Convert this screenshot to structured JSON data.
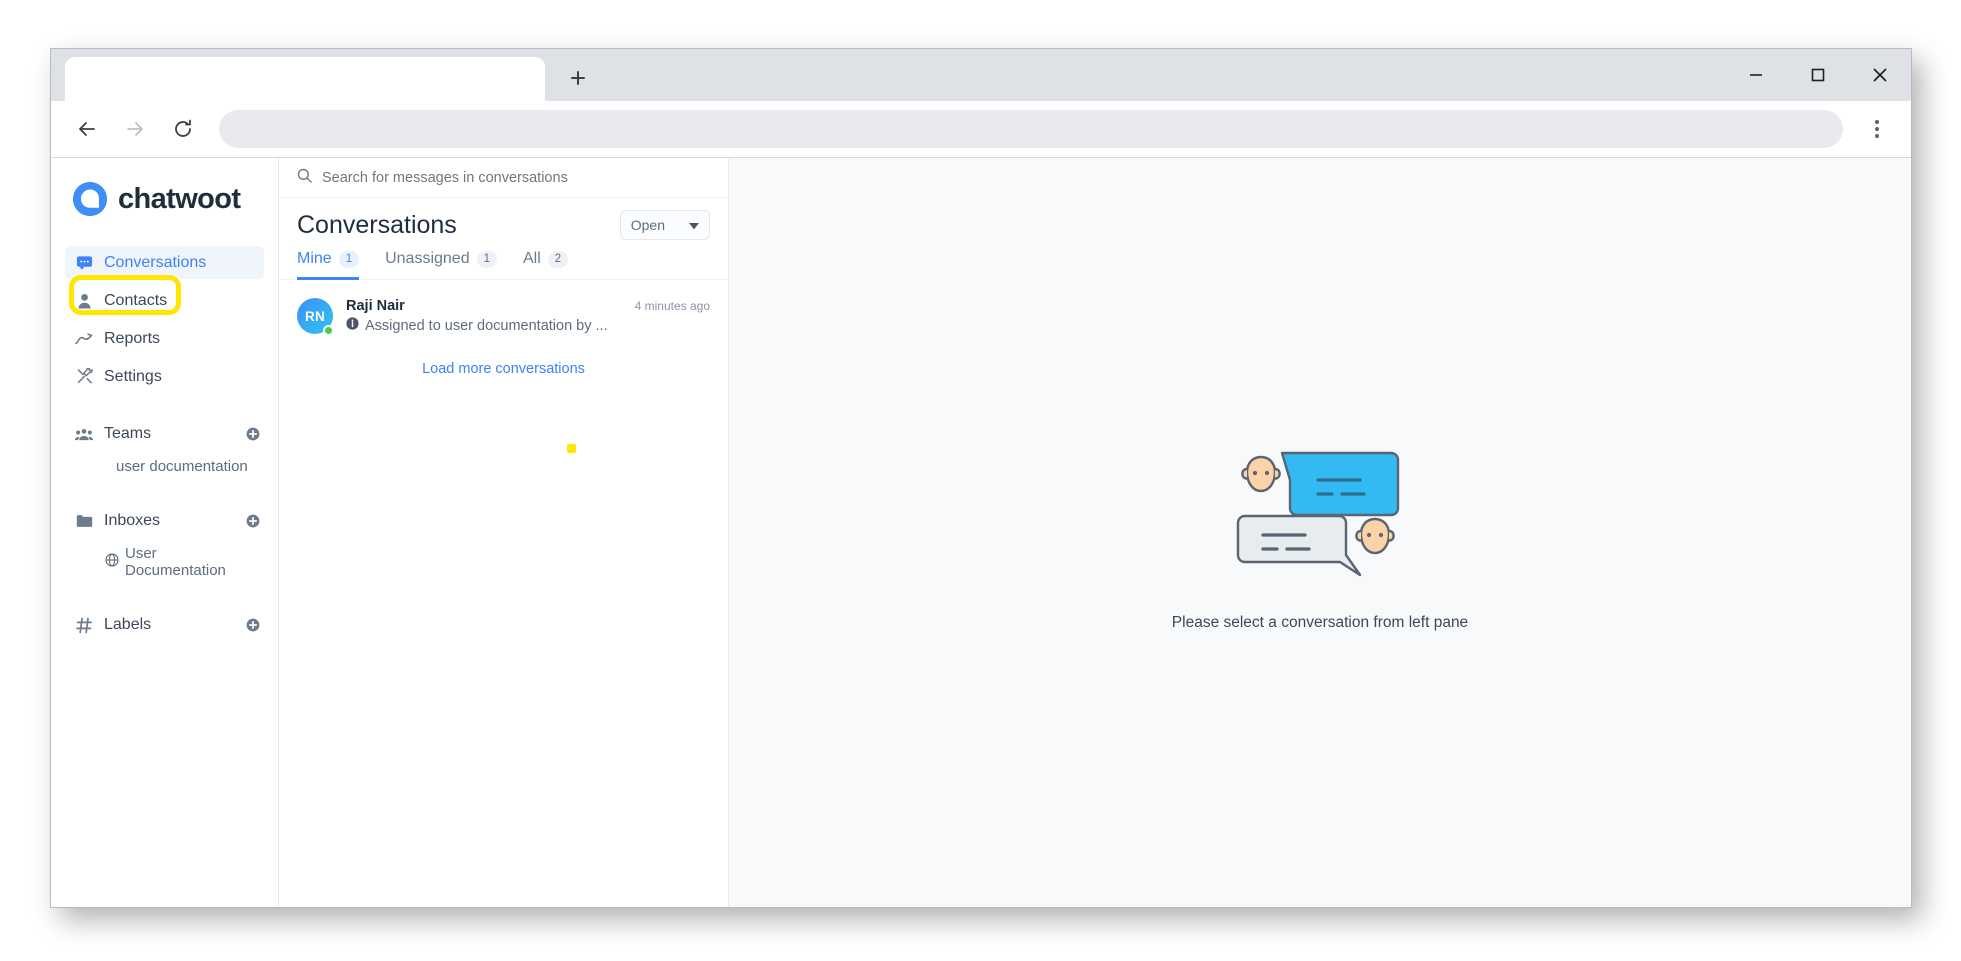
{
  "browser": {
    "tab": {
      "title": "",
      "name": "browser-tab"
    },
    "new_tab_label": "+",
    "address_value": "",
    "address_placeholder": "",
    "controls": {
      "minimize": "minimize-button",
      "maximize": "maximize-button",
      "close": "close-button"
    },
    "nav": {
      "back": "back-button",
      "forward": "forward-button",
      "reload": "reload-button",
      "menu": "browser-menu-button"
    }
  },
  "sidebar": {
    "brand": "chatwoot",
    "nav_items": [
      {
        "label": "Conversations",
        "icon": "chat-bubble-icon",
        "active": true
      },
      {
        "label": "Contacts",
        "icon": "person-icon",
        "active": false
      },
      {
        "label": "Reports",
        "icon": "trend-up-icon",
        "active": false
      },
      {
        "label": "Settings",
        "icon": "tools-icon",
        "active": false
      }
    ],
    "sections": [
      {
        "label": "Teams",
        "icon": "people-icon",
        "add_icon": "plus-circle-icon",
        "children": [
          {
            "label": "user documentation",
            "icon": ""
          }
        ]
      },
      {
        "label": "Inboxes",
        "icon": "folder-icon",
        "add_icon": "plus-circle-icon",
        "children": [
          {
            "label": "User Documentation",
            "icon": "globe-icon"
          }
        ]
      },
      {
        "label": "Labels",
        "icon": "hash-icon",
        "add_icon": "plus-circle-icon",
        "children": []
      }
    ]
  },
  "conversations": {
    "search_placeholder": "Search for messages in conversations",
    "search_value": "",
    "search_icon": "search-icon",
    "title": "Conversations",
    "status_filter": {
      "value": "Open",
      "caret": "chevron-down-icon"
    },
    "tabs": [
      {
        "label": "Mine",
        "count": "1",
        "active": true
      },
      {
        "label": "Unassigned",
        "count": "1",
        "active": false
      },
      {
        "label": "All",
        "count": "2",
        "active": false
      }
    ],
    "items": [
      {
        "initials": "RN",
        "name": "Raji Nair",
        "time": "4 minutes ago",
        "preview": "Assigned to user documentation by ...",
        "preview_icon": "info-icon",
        "online": true
      }
    ],
    "load_more_label": "Load more conversations"
  },
  "main": {
    "empty_text": "Please select a conversation from left pane",
    "illustration": "two-people-chatting-illustration"
  },
  "annotation": {
    "highlight_target": "Contacts",
    "color": "#ffe600"
  },
  "colors": {
    "accent": "#3e82f7",
    "brand_blue": "#3e8ef7",
    "online_green": "#44ce4b",
    "highlight_yellow": "#ffe600",
    "text_dark": "#1f2d3d",
    "text_muted": "#5d6c7f",
    "pane_bg": "#f8f9fb"
  }
}
